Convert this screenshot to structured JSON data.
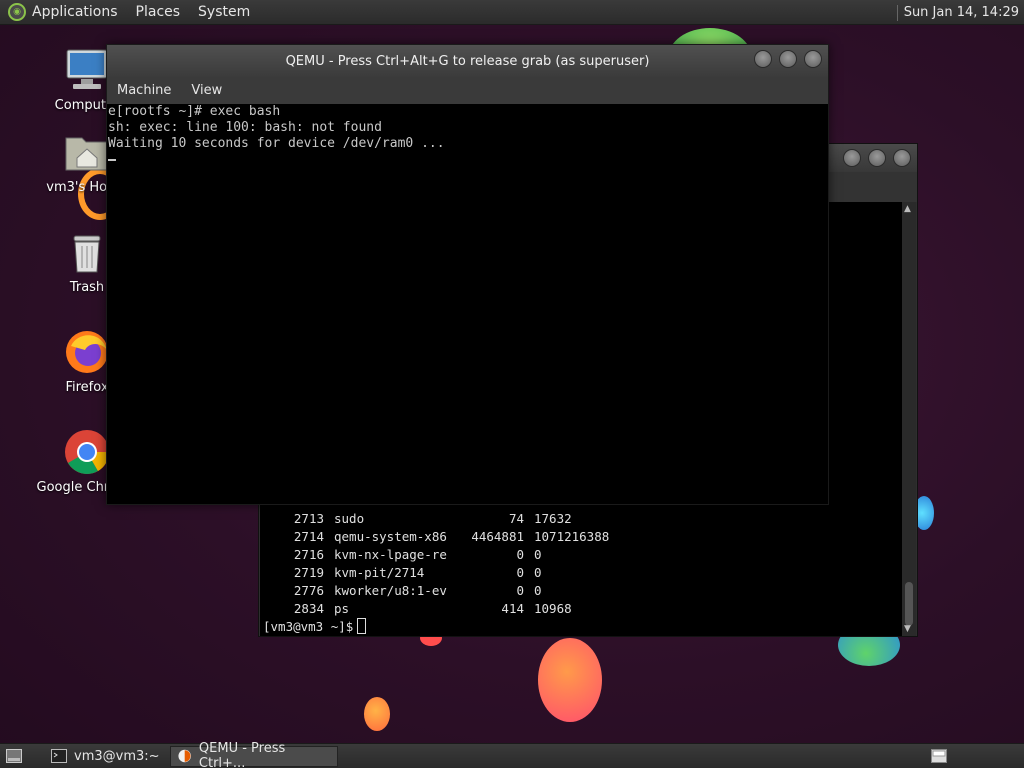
{
  "top_panel": {
    "menus": [
      "Applications",
      "Places",
      "System"
    ],
    "clock": "Sun Jan 14, 14:29"
  },
  "desktop_icons": [
    {
      "label": "Computer",
      "icon": "computer-icon"
    },
    {
      "label": "vm3's Home",
      "icon": "home-folder-icon"
    },
    {
      "label": "Trash",
      "icon": "trash-icon"
    },
    {
      "label": "Firefox",
      "icon": "firefox-icon"
    },
    {
      "label": "Google Chrome",
      "icon": "chrome-icon"
    }
  ],
  "terminal": {
    "ps_rows": [
      {
        "pid": "2713",
        "cmd": "sudo",
        "a": "74",
        "b": "17632"
      },
      {
        "pid": "2714",
        "cmd": "qemu-system-x86",
        "a": "4464881",
        "b": "1071216388"
      },
      {
        "pid": "2716",
        "cmd": "kvm-nx-lpage-re",
        "a": "0",
        "b": "0"
      },
      {
        "pid": "2719",
        "cmd": "kvm-pit/2714",
        "a": "0",
        "b": "0"
      },
      {
        "pid": "2776",
        "cmd": "kworker/u8:1-ev",
        "a": "0",
        "b": "0"
      },
      {
        "pid": "2834",
        "cmd": "ps",
        "a": "414",
        "b": "10968"
      }
    ],
    "prompt": "[vm3@vm3 ~]$"
  },
  "qemu": {
    "title": "QEMU - Press Ctrl+Alt+G to release grab (as superuser)",
    "menu": [
      "Machine",
      "View"
    ],
    "console_lines": [
      "e[rootfs ~]# exec bash",
      "sh: exec: line 100: bash: not found",
      "Waiting 10 seconds for device /dev/ram0 ..."
    ]
  },
  "taskbar": {
    "tasks": [
      "vm3@vm3:~",
      "QEMU - Press Ctrl+..."
    ]
  }
}
